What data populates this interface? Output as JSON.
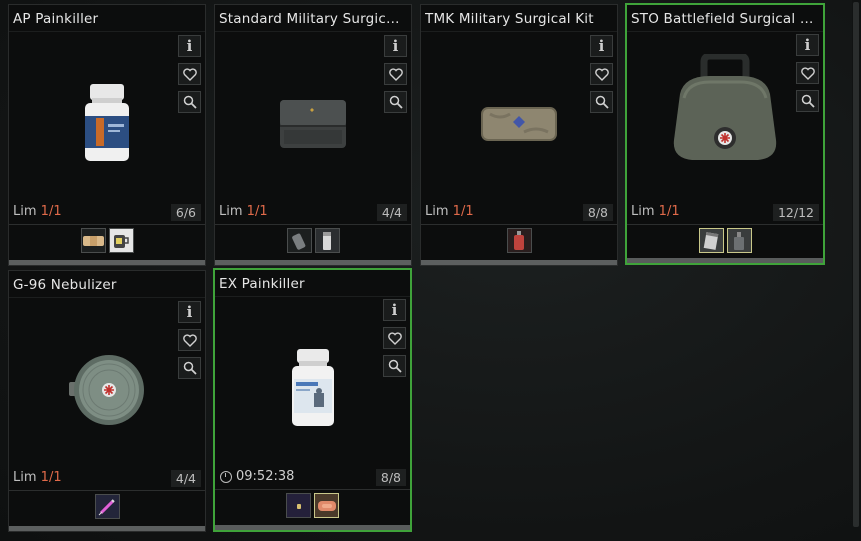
{
  "cards": [
    {
      "title": "AP Painkiller",
      "lim_label": "Lim",
      "lim_value": "1/1",
      "stock": "6/6",
      "icons": [
        "info-icon",
        "heart-icon",
        "magnifier-icon"
      ],
      "requirements": [
        "bandage-icon",
        "mug-icon"
      ]
    },
    {
      "title": "Standard Military Surgical...",
      "lim_label": "Lim",
      "lim_value": "1/1",
      "stock": "4/4",
      "icons": [
        "info-icon",
        "heart-icon",
        "magnifier-icon"
      ],
      "requirements": [
        "battery-icon",
        "tube-icon"
      ]
    },
    {
      "title": "TMK Military Surgical Kit",
      "lim_label": "Lim",
      "lim_value": "1/1",
      "stock": "8/8",
      "icons": [
        "info-icon",
        "heart-icon",
        "magnifier-icon"
      ],
      "requirements": [
        "canister-icon"
      ]
    },
    {
      "title": "STO Battlefield Surgical S...",
      "lim_label": "Lim",
      "lim_value": "1/1",
      "stock": "12/12",
      "icons": [
        "info-icon",
        "heart-icon",
        "magnifier-icon"
      ],
      "requirements": [
        "notepad-icon",
        "bottle-icon"
      ]
    },
    {
      "title": "G-96 Nebulizer",
      "lim_label": "Lim",
      "lim_value": "1/1",
      "stock": "4/4",
      "icons": [
        "info-icon",
        "heart-icon",
        "magnifier-icon"
      ],
      "requirements": [
        "syringe-icon"
      ]
    },
    {
      "title": "EX Painkiller",
      "timer": "09:52:38",
      "stock": "8/8",
      "icons": [
        "info-icon",
        "heart-icon",
        "magnifier-icon"
      ],
      "requirements": [
        "small-pill-icon",
        "soap-icon"
      ]
    }
  ],
  "colors": {
    "selected_border": "#3fa33a",
    "limit_value": "#e06a4a",
    "owned_requirement": "#c9c88a"
  }
}
